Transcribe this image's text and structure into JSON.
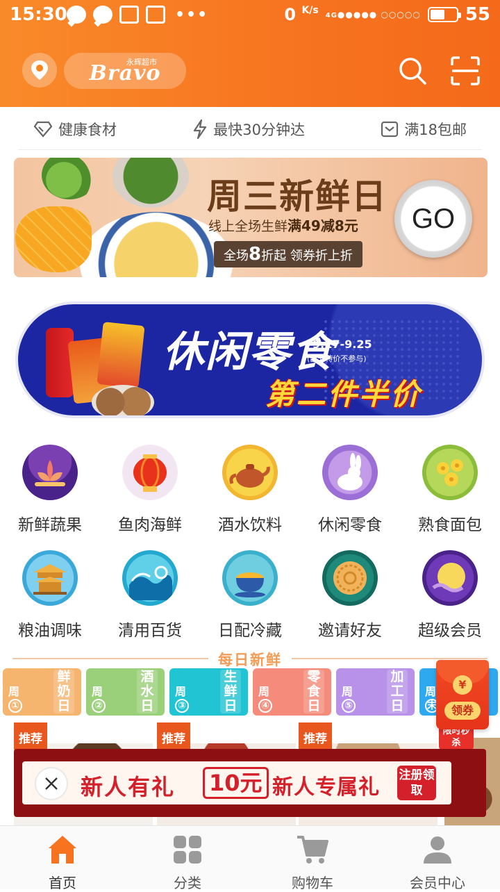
{
  "status_bar": {
    "time": "15:30",
    "network_speed": "0",
    "network_unit": "K/s",
    "signal_label": "4G",
    "battery_level": 55,
    "battery_text": "55"
  },
  "header": {
    "logo_small": "永辉超市",
    "logo_main": "Bravo",
    "accent_color": "#f7731f"
  },
  "features": [
    {
      "label": "健康食材",
      "icon": "diamond-icon"
    },
    {
      "label": "最快30分钟达",
      "icon": "lightning-icon"
    },
    {
      "label": "满18包邮",
      "icon": "envelope-icon"
    }
  ],
  "banner1": {
    "title": "周三新鲜日",
    "subtitle": "线上全场生鲜",
    "subtitle_bold": "满49减8元",
    "tag_prefix": "全场",
    "tag_num": "8",
    "tag_suffix": "折起 领券折上折",
    "go": "GO"
  },
  "banner2": {
    "title": "休闲零食",
    "date": "9.17-9.25",
    "note": "(部分特价不参与)",
    "promo": "第二件半价"
  },
  "categories": [
    {
      "label": "新鲜蔬果",
      "icon": "lotus-icon"
    },
    {
      "label": "鱼肉海鲜",
      "icon": "lantern-icon"
    },
    {
      "label": "酒水饮料",
      "icon": "teapot-icon"
    },
    {
      "label": "休闲零食",
      "icon": "rabbit-icon"
    },
    {
      "label": "熟食面包",
      "icon": "osmanthus-icon"
    },
    {
      "label": "粮油调味",
      "icon": "pavilion-icon"
    },
    {
      "label": "清用百货",
      "icon": "wave-icon"
    },
    {
      "label": "日配冷藏",
      "icon": "tea-cup-icon"
    },
    {
      "label": "邀请好友",
      "icon": "mooncake-icon"
    },
    {
      "label": "超级会员",
      "icon": "moon-icon"
    }
  ],
  "daily": {
    "heading": "每日新鲜",
    "days": [
      {
        "zhou": "周",
        "num": "①",
        "name": "鲜奶日",
        "color": "#f6b56f"
      },
      {
        "zhou": "周",
        "num": "②",
        "name": "酒水日",
        "color": "#9bd07b"
      },
      {
        "zhou": "周",
        "num": "③",
        "name": "生鲜日",
        "color": "#21c4d2"
      },
      {
        "zhou": "周",
        "num": "④",
        "name": "零食日",
        "color": "#f58c7b"
      },
      {
        "zhou": "周",
        "num": "⑤",
        "name": "加工日",
        "color": "#b892e8"
      },
      {
        "zhou": "周",
        "num": "末",
        "name": "",
        "color": "#2ea9ef"
      }
    ]
  },
  "products": {
    "tag": "推荐",
    "flash_sale": "限时秒杀"
  },
  "promo": {
    "text1": "新人有礼",
    "amount": "10元",
    "text2": "新人专属礼",
    "button": "注册领取"
  },
  "coupon": {
    "symbol": "¥",
    "label": "领券"
  },
  "nav": [
    {
      "label": "首页",
      "icon": "home-icon",
      "active": true
    },
    {
      "label": "分类",
      "icon": "grid-icon",
      "active": false
    },
    {
      "label": "购物车",
      "icon": "cart-icon",
      "active": false
    },
    {
      "label": "会员中心",
      "icon": "user-icon",
      "active": false
    }
  ]
}
